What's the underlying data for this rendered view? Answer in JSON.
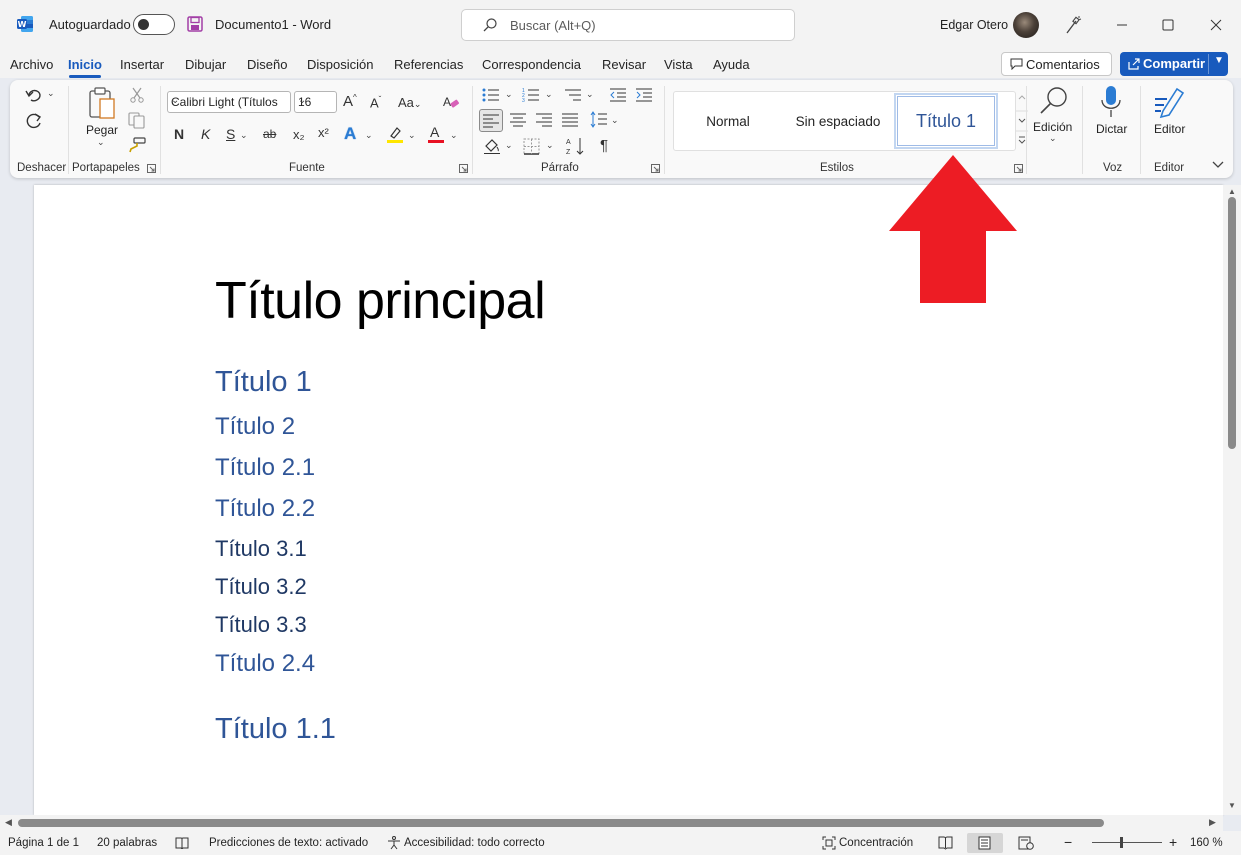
{
  "app": {
    "autosave_label": "Autoguardado",
    "doc_title": "Documento1  -  Word",
    "search_placeholder": "Buscar (Alt+Q)",
    "user_name": "Edgar Otero"
  },
  "menu": {
    "tabs": [
      "Archivo",
      "Inicio",
      "Insertar",
      "Dibujar",
      "Diseño",
      "Disposición",
      "Referencias",
      "Correspondencia",
      "Revisar",
      "Vista",
      "Ayuda"
    ],
    "active_tab": "Inicio",
    "comments_label": "Comentarios",
    "share_label": "Compartir"
  },
  "ribbon": {
    "groups": {
      "undo": "Deshacer",
      "clipboard": "Portapapeles",
      "font": "Fuente",
      "paragraph": "Párrafo",
      "styles": "Estilos",
      "voice": "Voz",
      "editor": "Editor"
    },
    "paste_label": "Pegar",
    "font_name": "Calibri Light (Títulos",
    "font_size": "16",
    "format_buttons": [
      "N",
      "K",
      "S",
      "ab",
      "x₂",
      "x²"
    ],
    "styles": [
      "Normal",
      "Sin espaciado",
      "Título 1"
    ],
    "selected_style": "Título 1",
    "editing_label": "Edición",
    "dictate_label": "Dictar",
    "editor_label": "Editor"
  },
  "document": {
    "title": "Título principal",
    "headings": [
      {
        "text": "Título 1",
        "level": 1
      },
      {
        "text": "Título 2",
        "level": 2
      },
      {
        "text": "Título 2.1",
        "level": 2
      },
      {
        "text": "Título 2.2",
        "level": 2
      },
      {
        "text": "Título 3.1",
        "level": 3
      },
      {
        "text": "Título 3.2",
        "level": 3
      },
      {
        "text": "Título 3.3",
        "level": 3
      },
      {
        "text": "Título 2.4",
        "level": 2
      },
      {
        "text": "Título 1.1",
        "level": 1
      }
    ]
  },
  "status": {
    "page": "Página 1 de 1",
    "words": "20 palabras",
    "predictions": "Predicciones de texto: activado",
    "accessibility": "Accesibilidad: todo correcto",
    "focus": "Concentración",
    "zoom": "160 %"
  },
  "colors": {
    "accent": "#185abd",
    "heading_blue": "#2f5597",
    "heading3_navy": "#1f3864",
    "arrow_red": "#ed1c24"
  },
  "toggles": {
    "autosave_on": false
  }
}
